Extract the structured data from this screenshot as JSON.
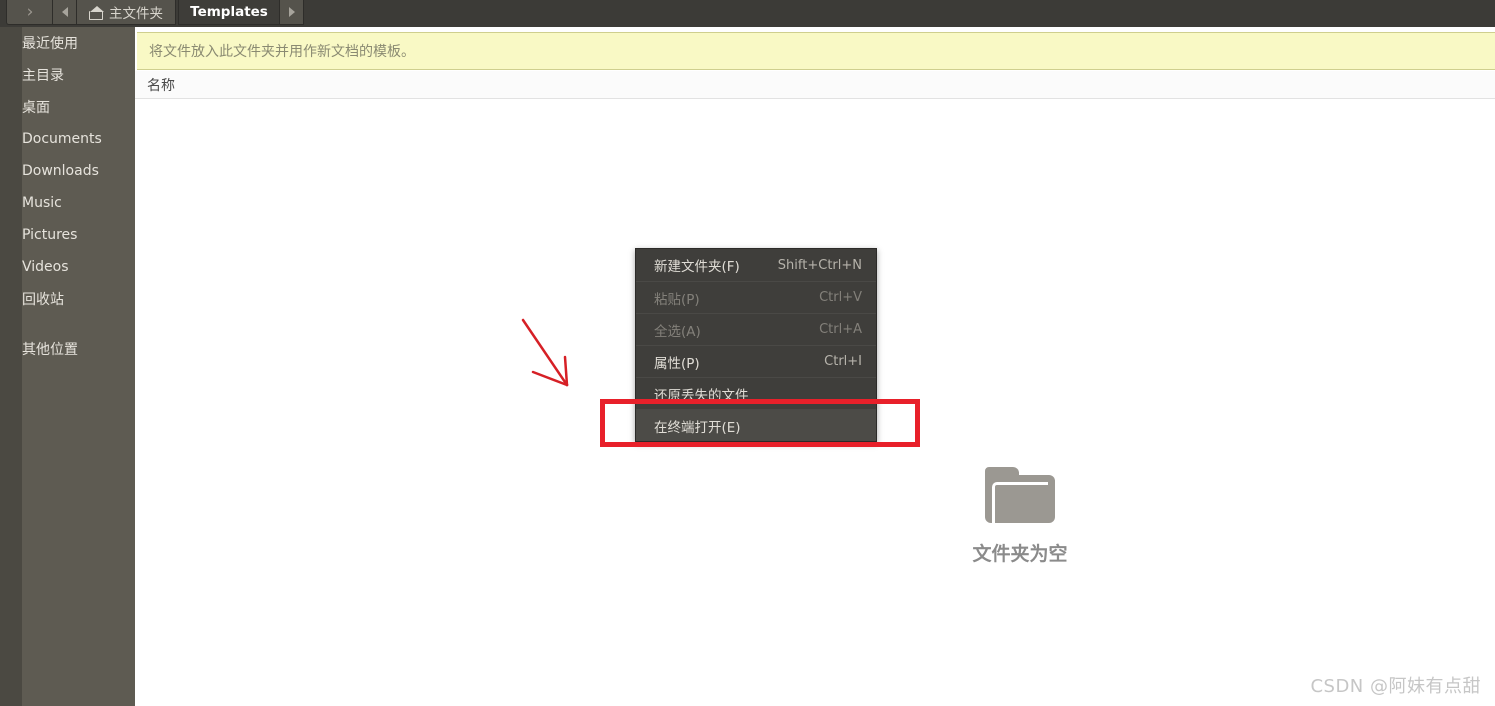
{
  "pathbar": {
    "prev_icon": "chevron-right-icon",
    "back_icon": "triangle-left-icon",
    "forward_icon": "triangle-right-icon",
    "home_icon": "home-icon",
    "home_label": "主文件夹",
    "active_tab": "Templates"
  },
  "sidebar": {
    "items": [
      {
        "label": "最近使用"
      },
      {
        "label": "主目录"
      },
      {
        "label": "桌面"
      },
      {
        "label": "Documents"
      },
      {
        "label": "Downloads"
      },
      {
        "label": "Music"
      },
      {
        "label": "Pictures"
      },
      {
        "label": "Videos"
      },
      {
        "label": "回收站"
      },
      {
        "label": "其他位置"
      }
    ]
  },
  "content": {
    "info_banner": "将文件放入此文件夹并用作新文档的模板。",
    "column_header_name": "名称",
    "empty_icon": "folder-icon",
    "empty_label": "文件夹为空"
  },
  "context_menu": {
    "items": [
      {
        "label": "新建文件夹(F)",
        "accel": "Shift+Ctrl+N",
        "disabled": false,
        "hover": false
      },
      {
        "label": "粘贴(P)",
        "accel": "Ctrl+V",
        "disabled": true,
        "hover": false
      },
      {
        "label": "全选(A)",
        "accel": "Ctrl+A",
        "disabled": true,
        "hover": false
      },
      {
        "label": "属性(P)",
        "accel": "Ctrl+I",
        "disabled": false,
        "hover": false
      },
      {
        "label": "还原丢失的文件",
        "accel": "",
        "disabled": false,
        "hover": false
      },
      {
        "label": "在终端打开(E)",
        "accel": "",
        "disabled": false,
        "hover": true
      }
    ]
  },
  "annotations": {
    "highlight_color": "#e8202a",
    "arrow_color": "#d62026",
    "highlight_target": "在终端打开(E)"
  },
  "watermark": "CSDN @阿妹有点甜"
}
